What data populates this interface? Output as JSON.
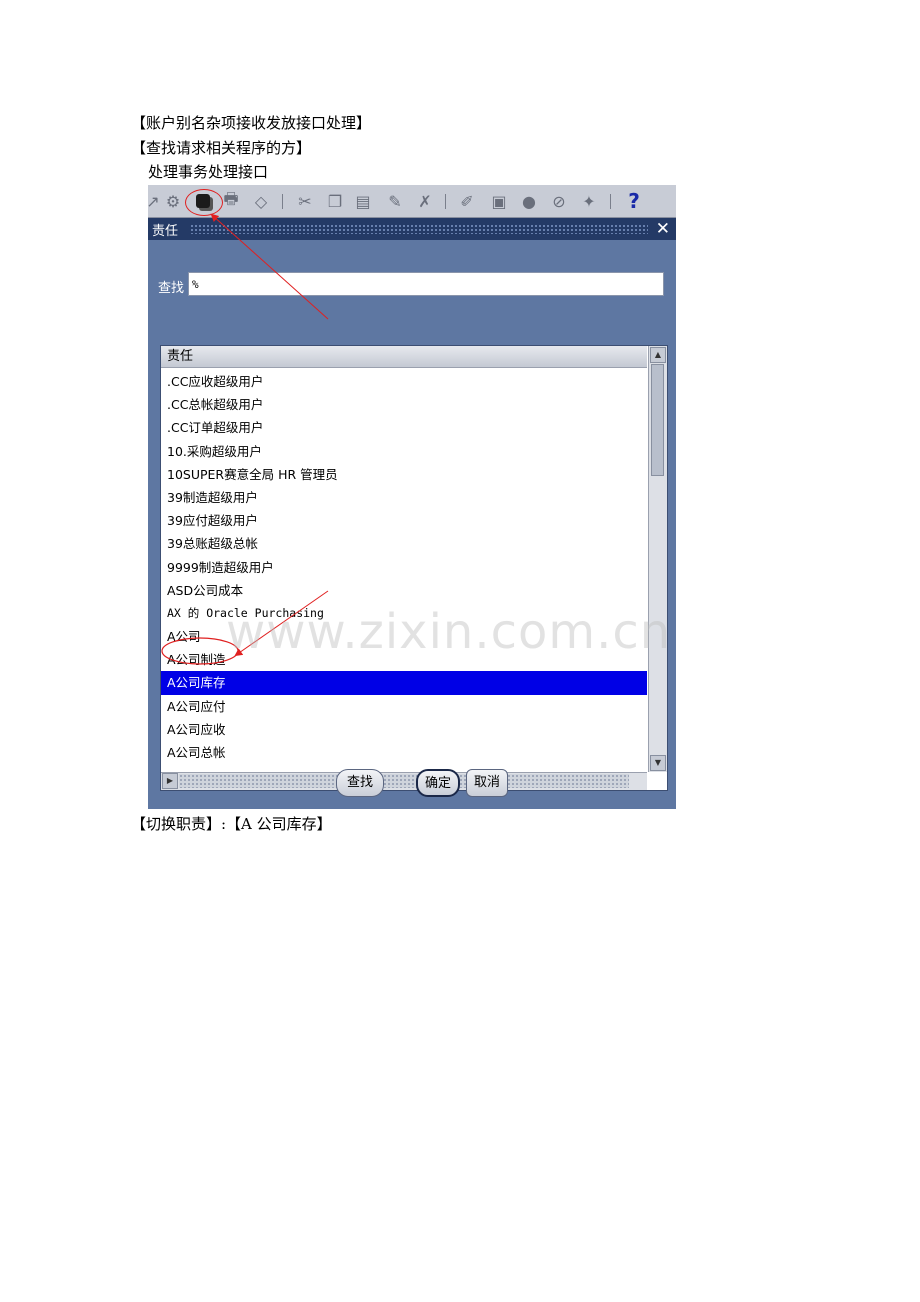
{
  "document": {
    "line1": "【账户别名杂项接收发放接口处理】",
    "line2": "【查找请求相关程序的方】",
    "line3": "处理事务处理接口",
    "line4": "【切换职责】:【A 公司库存】"
  },
  "toolbar": {
    "icons": [
      "arrow-icon",
      "gear-icon",
      "responsibility-icon",
      "print-icon",
      "folder-icon",
      "scissors-icon",
      "copy-icon",
      "paste-icon",
      "edit-icon",
      "clear-icon",
      "pencil-icon",
      "screen-icon",
      "globe-icon",
      "attachment-icon",
      "wand-icon",
      "help-icon"
    ],
    "help_label": "?"
  },
  "dialog": {
    "title": "责任",
    "close_label": "✕",
    "find_label": "查找",
    "find_value": "%",
    "list_header": "责任",
    "rows": [
      ".CC应收超级用户",
      ".CC总帐超级用户",
      ".CC订单超级用户",
      "10.采购超级用户",
      "10SUPER赛意全局 HR 管理员",
      "39制造超级用户",
      "39应付超级用户",
      "39总账超级总帐",
      "9999制造超级用户",
      "ASD公司成本",
      "AX 的 Oracle Purchasing",
      "A公司",
      "A公司制造",
      "A公司库存",
      "A公司应付",
      "A公司应收",
      "A公司总帐"
    ],
    "selected_row": "A公司库存",
    "buttons": {
      "find": "查找",
      "ok": "确定",
      "cancel": "取消"
    }
  },
  "watermark": "www.zixin.com.cn",
  "colors": {
    "dialog_bg": "#5e77a2",
    "title_bar": "#243a66",
    "selection": "#0000e6",
    "annotation": "#e02020"
  }
}
